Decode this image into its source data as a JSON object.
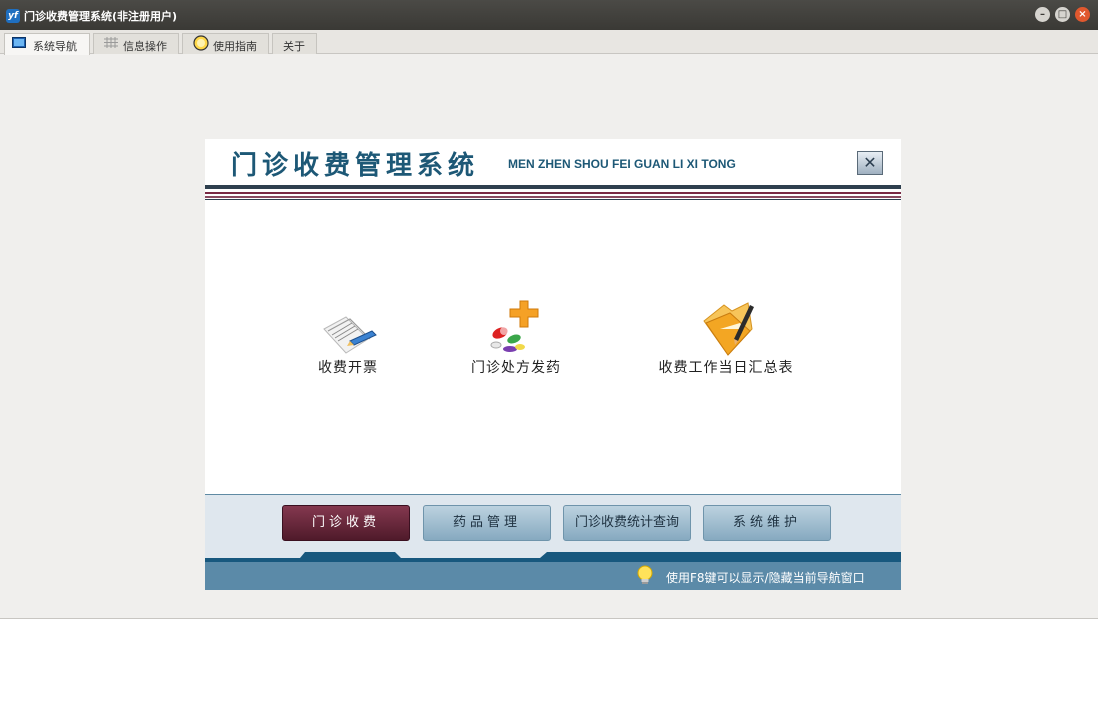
{
  "window": {
    "title": "门诊收费管理系统(非注册用户)",
    "app_icon": "yf",
    "controls": [
      "minimize-icon",
      "maximize-icon",
      "close-icon"
    ]
  },
  "tabs": [
    {
      "label": "系统导航",
      "icon": "monitor-icon",
      "active": true
    },
    {
      "label": "信息操作",
      "icon": "grid-icon",
      "active": false
    },
    {
      "label": "使用指南",
      "icon": "help-icon",
      "active": false
    },
    {
      "label": "关于",
      "icon": "",
      "active": false
    }
  ],
  "banner": {
    "title_cn": "门诊收费管理系统",
    "title_en": "MEN ZHEN SHOU FEI GUAN LI XI TONG",
    "close_glyph": "✕"
  },
  "features": [
    {
      "label": "收费开票",
      "icon": "invoice-pen-icon"
    },
    {
      "label": "门诊处方发药",
      "icon": "medicine-pills-icon"
    },
    {
      "label": "收费工作当日汇总表",
      "icon": "folder-pencil-icon"
    }
  ],
  "nav": [
    {
      "label": "门诊收费",
      "active": true
    },
    {
      "label": "药品管理",
      "active": false
    },
    {
      "label": "门诊收费统计查询",
      "active": false
    },
    {
      "label": "系统维护",
      "active": false
    }
  ],
  "status": {
    "hint": "使用F8键可以显示/隐藏当前导航窗口",
    "icon": "lightbulb-icon"
  },
  "colors": {
    "titlebar": "#3f3e3a",
    "banner_text": "#1d5876",
    "nav_active": "#5e2236",
    "nav_inactive": "#a3bfd0",
    "status_bar": "#5b8aa8",
    "close_button": "#e0582e"
  }
}
